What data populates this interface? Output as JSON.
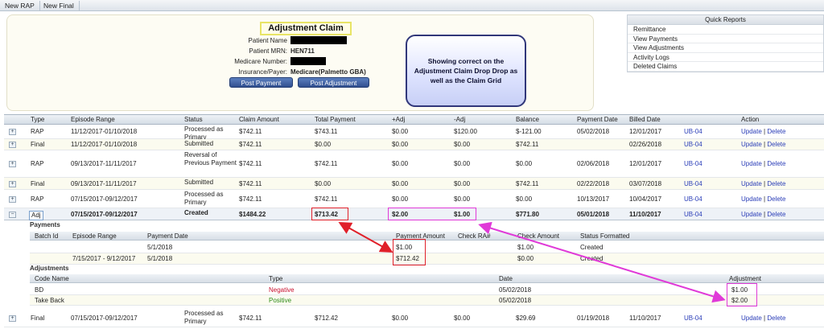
{
  "tabs": [
    "New RAP",
    "New Final"
  ],
  "claim": {
    "title": "Adjustment Claim",
    "labels": [
      "Patient Name",
      "Patient MRN:",
      "Medicare Number:",
      "Insurance/Payer:"
    ],
    "mrn": "HEN711",
    "payer": "Medicare(Palmetto GBA)",
    "post_payment": "Post Payment",
    "post_adjustment": "Post Adjustment"
  },
  "annotation": "Showing correct on the Adjustment Claim Drop Drop as well as the Claim Grid",
  "quick_reports": {
    "title": "Quick Reports",
    "items": [
      "Remittance",
      "View Payments",
      "View Adjustments",
      "Activity Logs",
      "Deleted Claims"
    ]
  },
  "grid": {
    "headers": [
      "Type",
      "Episode Range",
      "Status",
      "Claim Amount",
      "Total Payment",
      "+Adj",
      "-Adj",
      "Balance",
      "Payment Date",
      "Billed Date",
      "",
      "Action"
    ],
    "rows": [
      {
        "type": "RAP",
        "range": "11/12/2017-01/10/2018",
        "status": "Processed as Primary",
        "amount": "$742.11",
        "payment": "$743.11",
        "padj": "$0.00",
        "nadj": "$120.00",
        "balance": "$-121.00",
        "pdate": "05/02/2018",
        "bdate": "12/01/2017",
        "ub": "UB-04"
      },
      {
        "type": "Final",
        "range": "11/12/2017-01/10/2018",
        "status": "Submitted",
        "amount": "$742.11",
        "payment": "$0.00",
        "padj": "$0.00",
        "nadj": "$0.00",
        "balance": "$742.11",
        "pdate": "",
        "bdate": "02/26/2018",
        "ub": "UB-04"
      },
      {
        "type": "RAP",
        "range": "09/13/2017-11/11/2017",
        "status": "Reversal of Previous Payment",
        "amount": "$742.11",
        "payment": "$742.11",
        "padj": "$0.00",
        "nadj": "$0.00",
        "balance": "$0.00",
        "pdate": "02/06/2018",
        "bdate": "12/01/2017",
        "ub": "UB-04"
      },
      {
        "type": "Final",
        "range": "09/13/2017-11/11/2017",
        "status": "Submitted",
        "amount": "$742.11",
        "payment": "$0.00",
        "padj": "$0.00",
        "nadj": "$0.00",
        "balance": "$742.11",
        "pdate": "02/22/2018",
        "bdate": "03/07/2018",
        "ub": "UB-04"
      },
      {
        "type": "RAP",
        "range": "07/15/2017-09/12/2017",
        "status": "Processed as Primary",
        "amount": "$742.11",
        "payment": "$742.11",
        "padj": "$0.00",
        "nadj": "$0.00",
        "balance": "$0.00",
        "pdate": "10/13/2017",
        "bdate": "10/04/2017",
        "ub": "UB-04"
      },
      {
        "type": "Adj",
        "range": "07/15/2017-09/12/2017",
        "status": "Created",
        "amount": "$1484.22",
        "payment": "$713.42",
        "padj": "$2.00",
        "nadj": "$1.00",
        "balance": "$771.80",
        "pdate": "05/01/2018",
        "bdate": "11/10/2017",
        "ub": "UB-04"
      }
    ],
    "last_row": {
      "type": "Final",
      "range": "07/15/2017-09/12/2017",
      "status": "Processed as Primary",
      "amount": "$742.11",
      "payment": "$712.42",
      "padj": "$0.00",
      "nadj": "$0.00",
      "balance": "$29.69",
      "pdate": "01/19/2018",
      "bdate": "11/10/2017",
      "ub": "UB-04"
    },
    "update": "Update",
    "sep": " | ",
    "delete": "Delete"
  },
  "payments": {
    "label": "Payments",
    "headers": [
      "Batch Id",
      "Episode Range",
      "Payment Date",
      "Payment Amount",
      "Check RA#",
      "Check Amount",
      "Status Formatted"
    ],
    "rows": [
      {
        "batch": "",
        "range": "",
        "date": "5/1/2018",
        "amount": "$1.00",
        "ra": "",
        "check": "$1.00",
        "status": "Created"
      },
      {
        "batch": "",
        "range": "7/15/2017 - 9/12/2017",
        "date": "5/1/2018",
        "amount": "$712.42",
        "ra": "",
        "check": "$0.00",
        "status": "Created"
      }
    ]
  },
  "adjustments": {
    "label": "Adjustments",
    "headers": [
      "Code Name",
      "Type",
      "Date",
      "Adjustment"
    ],
    "rows": [
      {
        "code": "BD",
        "type": "Negative",
        "date": "05/02/2018",
        "amount": "$1.00"
      },
      {
        "code": "Take Back",
        "type": "Positive",
        "date": "05/02/2018",
        "amount": "$2.00"
      }
    ]
  },
  "colors": {
    "link": "#2a3db8",
    "negative": "#c8102e",
    "positive": "#2e8b18",
    "red_highlight": "#e0202a",
    "magenta_highlight": "#e03ad8"
  }
}
